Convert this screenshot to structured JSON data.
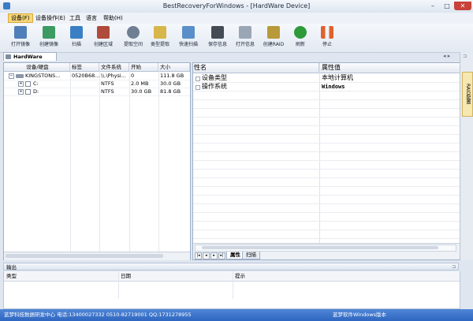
{
  "window": {
    "title": "BestRecoveryForWindows - [HardWare Device]"
  },
  "menu": [
    "设备(F)",
    "设备操作(E)",
    "工具",
    "语言",
    "帮助(H)"
  ],
  "toolbar": [
    {
      "label": "打开镜像",
      "icon": "open-image-icon",
      "color": "#4e7fb8"
    },
    {
      "label": "创建镜像",
      "icon": "create-image-icon",
      "color": "#3b9b62"
    },
    {
      "label": "扫描",
      "icon": "scan-icon",
      "color": "#3a7fc4"
    },
    {
      "label": "创建区域",
      "icon": "create-region-icon",
      "color": "#b04a3a"
    },
    {
      "label": "提取空间",
      "icon": "extract-space-icon",
      "color": "#6f7f93"
    },
    {
      "label": "类型提取",
      "icon": "type-extract-icon",
      "color": "#d7b64a"
    },
    {
      "label": "快速扫描",
      "icon": "quick-scan-icon",
      "color": "#5a8fc9"
    },
    {
      "label": "保存信息",
      "icon": "save-info-icon",
      "color": "#444b55"
    },
    {
      "label": "打开信息",
      "icon": "open-info-icon",
      "color": "#9aa6b5"
    },
    {
      "label": "创建RAID",
      "icon": "create-raid-icon",
      "color": "#b89a3a"
    },
    {
      "label": "刷新",
      "icon": "refresh-icon",
      "color": "#2e9a3a"
    },
    {
      "label": "停止",
      "icon": "stop-icon",
      "color": "#e0622e"
    }
  ],
  "left": {
    "tab": "HardWare Device",
    "columns": [
      "设备/硬盘",
      "标签",
      "文件系统",
      "开始",
      "大小"
    ],
    "rows": [
      [
        "KINGSTONS...",
        "0520B68...",
        "\\\\.\\Physi...",
        "0",
        "111.8 GB"
      ],
      [
        "C:",
        "",
        "NTFS",
        "2.0 MB",
        "30.0 GB"
      ],
      [
        "D:",
        "",
        "NTFS",
        "30.0 GB",
        "81.8 GB"
      ]
    ]
  },
  "right": {
    "columns": [
      "性名",
      "属性值"
    ],
    "rows": [
      [
        "设备类型",
        "本地计算机"
      ],
      [
        "操作系统",
        "Windows"
      ]
    ],
    "tabs": [
      "属性",
      "扫描"
    ]
  },
  "side_tab": "RAID配置",
  "output": {
    "title": "输出",
    "columns": [
      "类型",
      "日期",
      "提示"
    ]
  },
  "status": {
    "left": "蓝梦科技数据研发中心 电话:13400027332 0510-82719001 QQ:1731278955",
    "right": "蓝梦软件Windows版本"
  }
}
